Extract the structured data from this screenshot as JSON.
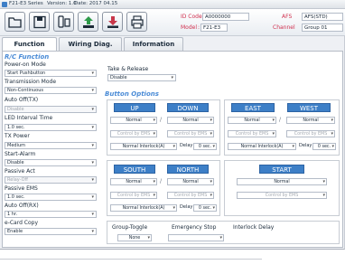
{
  "titlebar": {
    "series": "F21-E3 Series",
    "version": "Version: 1.0",
    "date": "Date: 2017 04.15"
  },
  "toolbar": {
    "buttons": [
      {
        "icon": "folder-open-icon"
      },
      {
        "icon": "save-icon"
      },
      {
        "icon": "device-read-icon"
      },
      {
        "icon": "upload-icon"
      },
      {
        "icon": "download-icon"
      },
      {
        "icon": "print-icon"
      }
    ],
    "id_code_label": "ID Code",
    "id_code_value": "A0000000",
    "model_label": "Model",
    "model_value": "F21-E3",
    "afs_label": "AFS",
    "afs_value": "AFS(STD)",
    "channel_label": "Channel",
    "channel_value": "Group 01"
  },
  "tabs": [
    {
      "label": "Function"
    },
    {
      "label": "Wiring Diag."
    },
    {
      "label": "Information"
    }
  ],
  "rc_function": {
    "title": "R/C Function",
    "fields": [
      {
        "label": "Power-on Mode",
        "value": "Start Pushbutton"
      },
      {
        "label": "Transmission Mode",
        "value": "Non-Continuous"
      },
      {
        "label": "Auto Off(TX)",
        "value": "Disable"
      },
      {
        "label": "LED Interval Time",
        "value": "1.0 sec."
      },
      {
        "label": "TX Power",
        "value": "Medium"
      },
      {
        "label": "Start-Alarm",
        "value": "Disable"
      },
      {
        "label": "Passive Act",
        "value": "Relay-Off"
      },
      {
        "label": "Passive EMS",
        "value": "1.0 sec."
      },
      {
        "label": "Auto Off(RX)",
        "value": "1 hr."
      },
      {
        "label": "e-Card Copy",
        "value": "Enable"
      }
    ]
  },
  "take_release": {
    "label": "Take & Release",
    "value": "Disable"
  },
  "button_options": {
    "title": "Button Options",
    "groups": [
      {
        "buttons": [
          "UP",
          "DOWN"
        ],
        "mode": [
          "Normal",
          "Normal"
        ],
        "ems": [
          "Control by EMS",
          "Control by EMS"
        ],
        "interlock": "Normal Interlock(A)",
        "delay_label": "Delay",
        "delay": "0 sec."
      },
      {
        "buttons": [
          "EAST",
          "WEST"
        ],
        "mode": [
          "Normal",
          "Normal"
        ],
        "ems": [
          "Control by EMS",
          "Control by EMS"
        ],
        "interlock": "Normal Interlock(A)",
        "delay_label": "Delay",
        "delay": "0 sec."
      },
      {
        "buttons": [
          "SOUTH",
          "NORTH"
        ],
        "mode": [
          "Normal",
          "Normal"
        ],
        "ems": [
          "Control by EMS",
          "Control by EMS"
        ],
        "interlock": "Normal Interlock(A)",
        "delay_label": "Delay",
        "delay": "0 sec."
      },
      {
        "buttons": [
          "START"
        ],
        "mode": [
          "Normal"
        ],
        "ems": [
          "Control by EMS"
        ]
      }
    ]
  },
  "bottom": {
    "group_toggle_label": "Group-Toggle",
    "group_toggle_value": "None",
    "emergency_stop_label": "Emergency Stop",
    "interlock_delay_label": "Interlock Delay"
  }
}
